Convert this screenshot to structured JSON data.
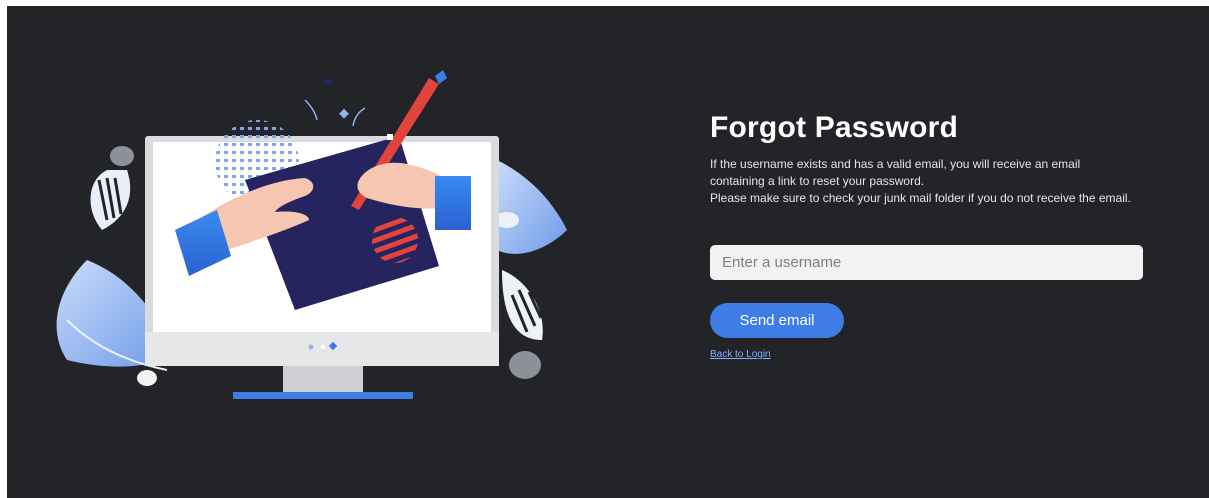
{
  "illustration": {
    "icon": "computer-signing-document-illustration",
    "colors": {
      "accent_blue": "#3f7de6",
      "navy": "#25245e",
      "pen_red": "#e0443d",
      "skin": "#f6c6b0",
      "leaf_light": "#a9c4f2"
    }
  },
  "form": {
    "title": "Forgot Password",
    "description_lines": [
      "If the username exists and has a valid email, you will receive an email",
      "containing a link to reset your password.",
      "Please make sure to check your junk mail folder if you do not receive the email."
    ],
    "username_placeholder": "Enter a username",
    "username_value": "",
    "send_label": "Send email",
    "back_label": "Back to Login"
  },
  "colors": {
    "background": "#222428",
    "primary_button": "#3f7de6",
    "link": "#7fb2ff",
    "input_bg": "#f2f2f3"
  }
}
